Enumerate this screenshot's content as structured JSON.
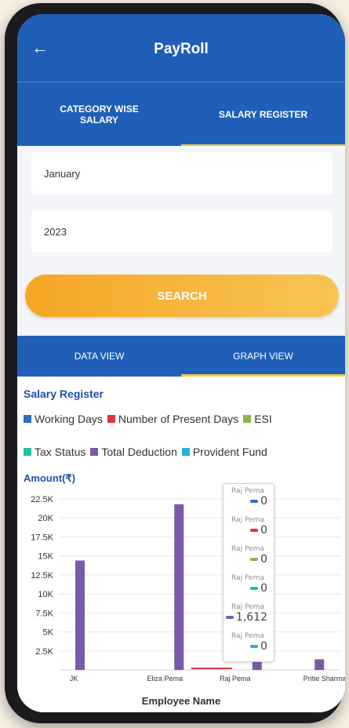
{
  "header": {
    "title": "PayRoll",
    "back_icon": "arrow-left-icon"
  },
  "top_tabs": [
    {
      "label": "CATEGORY WISE SALARY",
      "active": false
    },
    {
      "label": "SALARY REGISTER",
      "active": true
    }
  ],
  "form": {
    "month_value": "January",
    "year_value": "2023",
    "search_label": "SEARCH"
  },
  "view_tabs": [
    {
      "label": "DATA VIEW",
      "active": false
    },
    {
      "label": "GRAPH VIEW",
      "active": true
    }
  ],
  "section_title": "Salary Register",
  "colors": {
    "primary": "#1f5fb8",
    "accent": "#f5a623",
    "tab_indicator": "#f2c744"
  },
  "chart_data": {
    "type": "bar",
    "ylabel": "Amount(₹)",
    "xlabel": "Employee Name",
    "ylim": [
      0,
      22500
    ],
    "yticks": [
      "22.5K",
      "20K",
      "17.5K",
      "15K",
      "12.5K",
      "10K",
      "7.5K",
      "5K",
      "2.5K"
    ],
    "categories": [
      "JK",
      "Eliza Pema",
      "Raj Pema",
      "Pritie Sharma"
    ],
    "category_labels": [
      "JK",
      "Eliza Pema",
      "Raj Pema",
      "Pritie Sharma"
    ],
    "series": [
      {
        "name": "Working Days",
        "color": "#2f6fc0",
        "values": [
          0,
          0,
          0,
          0
        ]
      },
      {
        "name": "Number of Present Days",
        "color": "#d9363e",
        "values": [
          0,
          0,
          0,
          0
        ]
      },
      {
        "name": "ESI",
        "color": "#8fb34a",
        "values": [
          0,
          0,
          0,
          0
        ]
      },
      {
        "name": "Tax Status",
        "color": "#22c0a0",
        "values": [
          0,
          0,
          0,
          0
        ]
      },
      {
        "name": "Total Deduction",
        "color": "#7a5aa8",
        "values": [
          14400,
          21800,
          1612,
          1400
        ]
      },
      {
        "name": "Provident Fund",
        "color": "#22b3d6",
        "values": [
          0,
          0,
          0,
          0
        ]
      }
    ],
    "tooltip": {
      "category": "Raj Pema",
      "rows": [
        {
          "name": "Raj Pema",
          "value": "0",
          "color": "#2f6fc0"
        },
        {
          "name": "Raj Pema",
          "value": "0",
          "color": "#d9363e"
        },
        {
          "name": "Raj Pema",
          "value": "0",
          "color": "#8fb34a"
        },
        {
          "name": "Raj Pema",
          "value": "0",
          "color": "#22c0a0"
        },
        {
          "name": "Raj Pema",
          "value": "1,612",
          "color": "#7a5aa8"
        },
        {
          "name": "Raj Pema",
          "value": "0",
          "color": "#22b3d6"
        }
      ]
    }
  }
}
